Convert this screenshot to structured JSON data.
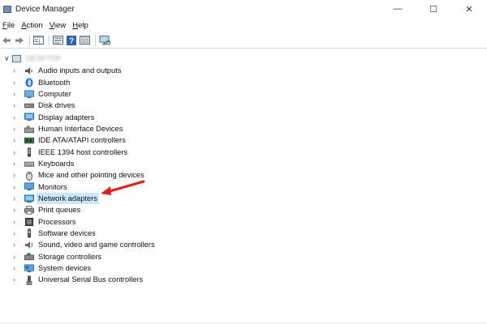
{
  "window": {
    "title": "Device Manager",
    "minimize_glyph": "—",
    "maximize_glyph": "☐",
    "close_glyph": "✕"
  },
  "menu": {
    "items": [
      {
        "underline": "F",
        "rest": "ile"
      },
      {
        "underline": "A",
        "rest": "ction"
      },
      {
        "underline": "V",
        "rest": "iew"
      },
      {
        "underline": "H",
        "rest": "elp"
      }
    ]
  },
  "toolbar": {
    "icons": [
      "back-icon",
      "forward-icon",
      "properties-icon",
      "update-driver-icon",
      "help-icon",
      "show-hidden-icon",
      "scan-hardware-icon"
    ]
  },
  "tree": {
    "root_label": "DESKTOP",
    "categories": [
      {
        "label": "Audio inputs and outputs",
        "icon": "audio-icon"
      },
      {
        "label": "Bluetooth",
        "icon": "bluetooth-icon"
      },
      {
        "label": "Computer",
        "icon": "computer-icon"
      },
      {
        "label": "Disk drives",
        "icon": "disk-drive-icon"
      },
      {
        "label": "Display adapters",
        "icon": "display-adapter-icon"
      },
      {
        "label": "Human Interface Devices",
        "icon": "hid-icon"
      },
      {
        "label": "IDE ATA/ATAPI controllers",
        "icon": "ide-controller-icon"
      },
      {
        "label": "IEEE 1394 host controllers",
        "icon": "ieee1394-icon"
      },
      {
        "label": "Keyboards",
        "icon": "keyboard-icon"
      },
      {
        "label": "Mice and other pointing devices",
        "icon": "mouse-icon"
      },
      {
        "label": "Monitors",
        "icon": "monitor-icon"
      },
      {
        "label": "Network adapters",
        "icon": "network-adapter-icon"
      },
      {
        "label": "Print queues",
        "icon": "printer-icon"
      },
      {
        "label": "Processors",
        "icon": "processor-icon"
      },
      {
        "label": "Software devices",
        "icon": "software-device-icon"
      },
      {
        "label": "Sound, video and game controllers",
        "icon": "sound-controller-icon"
      },
      {
        "label": "Storage controllers",
        "icon": "storage-controller-icon"
      },
      {
        "label": "System devices",
        "icon": "system-device-icon"
      },
      {
        "label": "Universal Serial Bus controllers",
        "icon": "usb-icon"
      }
    ],
    "selected_index": 11
  },
  "colors": {
    "selection": "#cce8ff",
    "arrow": "#e0201b",
    "accent": "#0078d7"
  }
}
